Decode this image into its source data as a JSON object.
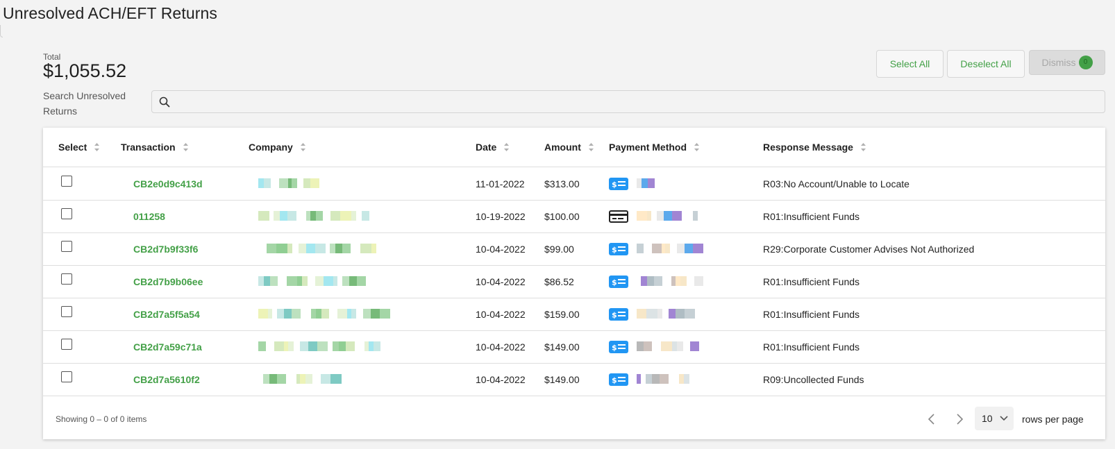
{
  "page": {
    "title": "Unresolved ACH/EFT Returns"
  },
  "summary": {
    "total_label": "Total",
    "total_value": "$1,055.52"
  },
  "search": {
    "label": "Search Unresolved Returns",
    "value": "",
    "placeholder": ""
  },
  "toolbar": {
    "select_all_label": "Select All",
    "deselect_all_label": "Deselect All",
    "dismiss_label": "Dismiss",
    "dismiss_count": "0"
  },
  "table": {
    "columns": [
      "Select",
      "Transaction",
      "Company",
      "Date",
      "Amount",
      "Payment Method",
      "Response Message"
    ],
    "rows": [
      {
        "transaction": "CB2e0d9c413d",
        "date": "11-01-2022",
        "amount": "$313.00",
        "method_icon": "ach-icon",
        "response": "R03:No Account/Unable to Locate"
      },
      {
        "transaction": "011258",
        "date": "10-19-2022",
        "amount": "$100.00",
        "method_icon": "credit-card-icon",
        "response": "R01:Insufficient Funds"
      },
      {
        "transaction": "CB2d7b9f33f6",
        "date": "10-04-2022",
        "amount": "$99.00",
        "method_icon": "ach-icon",
        "response": "R29:Corporate Customer Advises Not Authorized"
      },
      {
        "transaction": "CB2d7b9b06ee",
        "date": "10-04-2022",
        "amount": "$86.52",
        "method_icon": "ach-icon",
        "response": "R01:Insufficient Funds"
      },
      {
        "transaction": "CB2d7a5f5a54",
        "date": "10-04-2022",
        "amount": "$159.00",
        "method_icon": "ach-icon",
        "response": "R01:Insufficient Funds"
      },
      {
        "transaction": "CB2d7a59c71a",
        "date": "10-04-2022",
        "amount": "$149.00",
        "method_icon": "ach-icon",
        "response": "R01:Insufficient Funds"
      },
      {
        "transaction": "CB2d7a5610f2",
        "date": "10-04-2022",
        "amount": "$149.00",
        "method_icon": "ach-icon",
        "response": "R09:Uncollected Funds"
      }
    ]
  },
  "footer": {
    "info": "Showing 0 – 0 of 0 items",
    "page_size": "10",
    "rows_per_page_label": "rows per page"
  },
  "colors": {
    "accent": "#43a047",
    "ach_icon": "#2196f3"
  }
}
